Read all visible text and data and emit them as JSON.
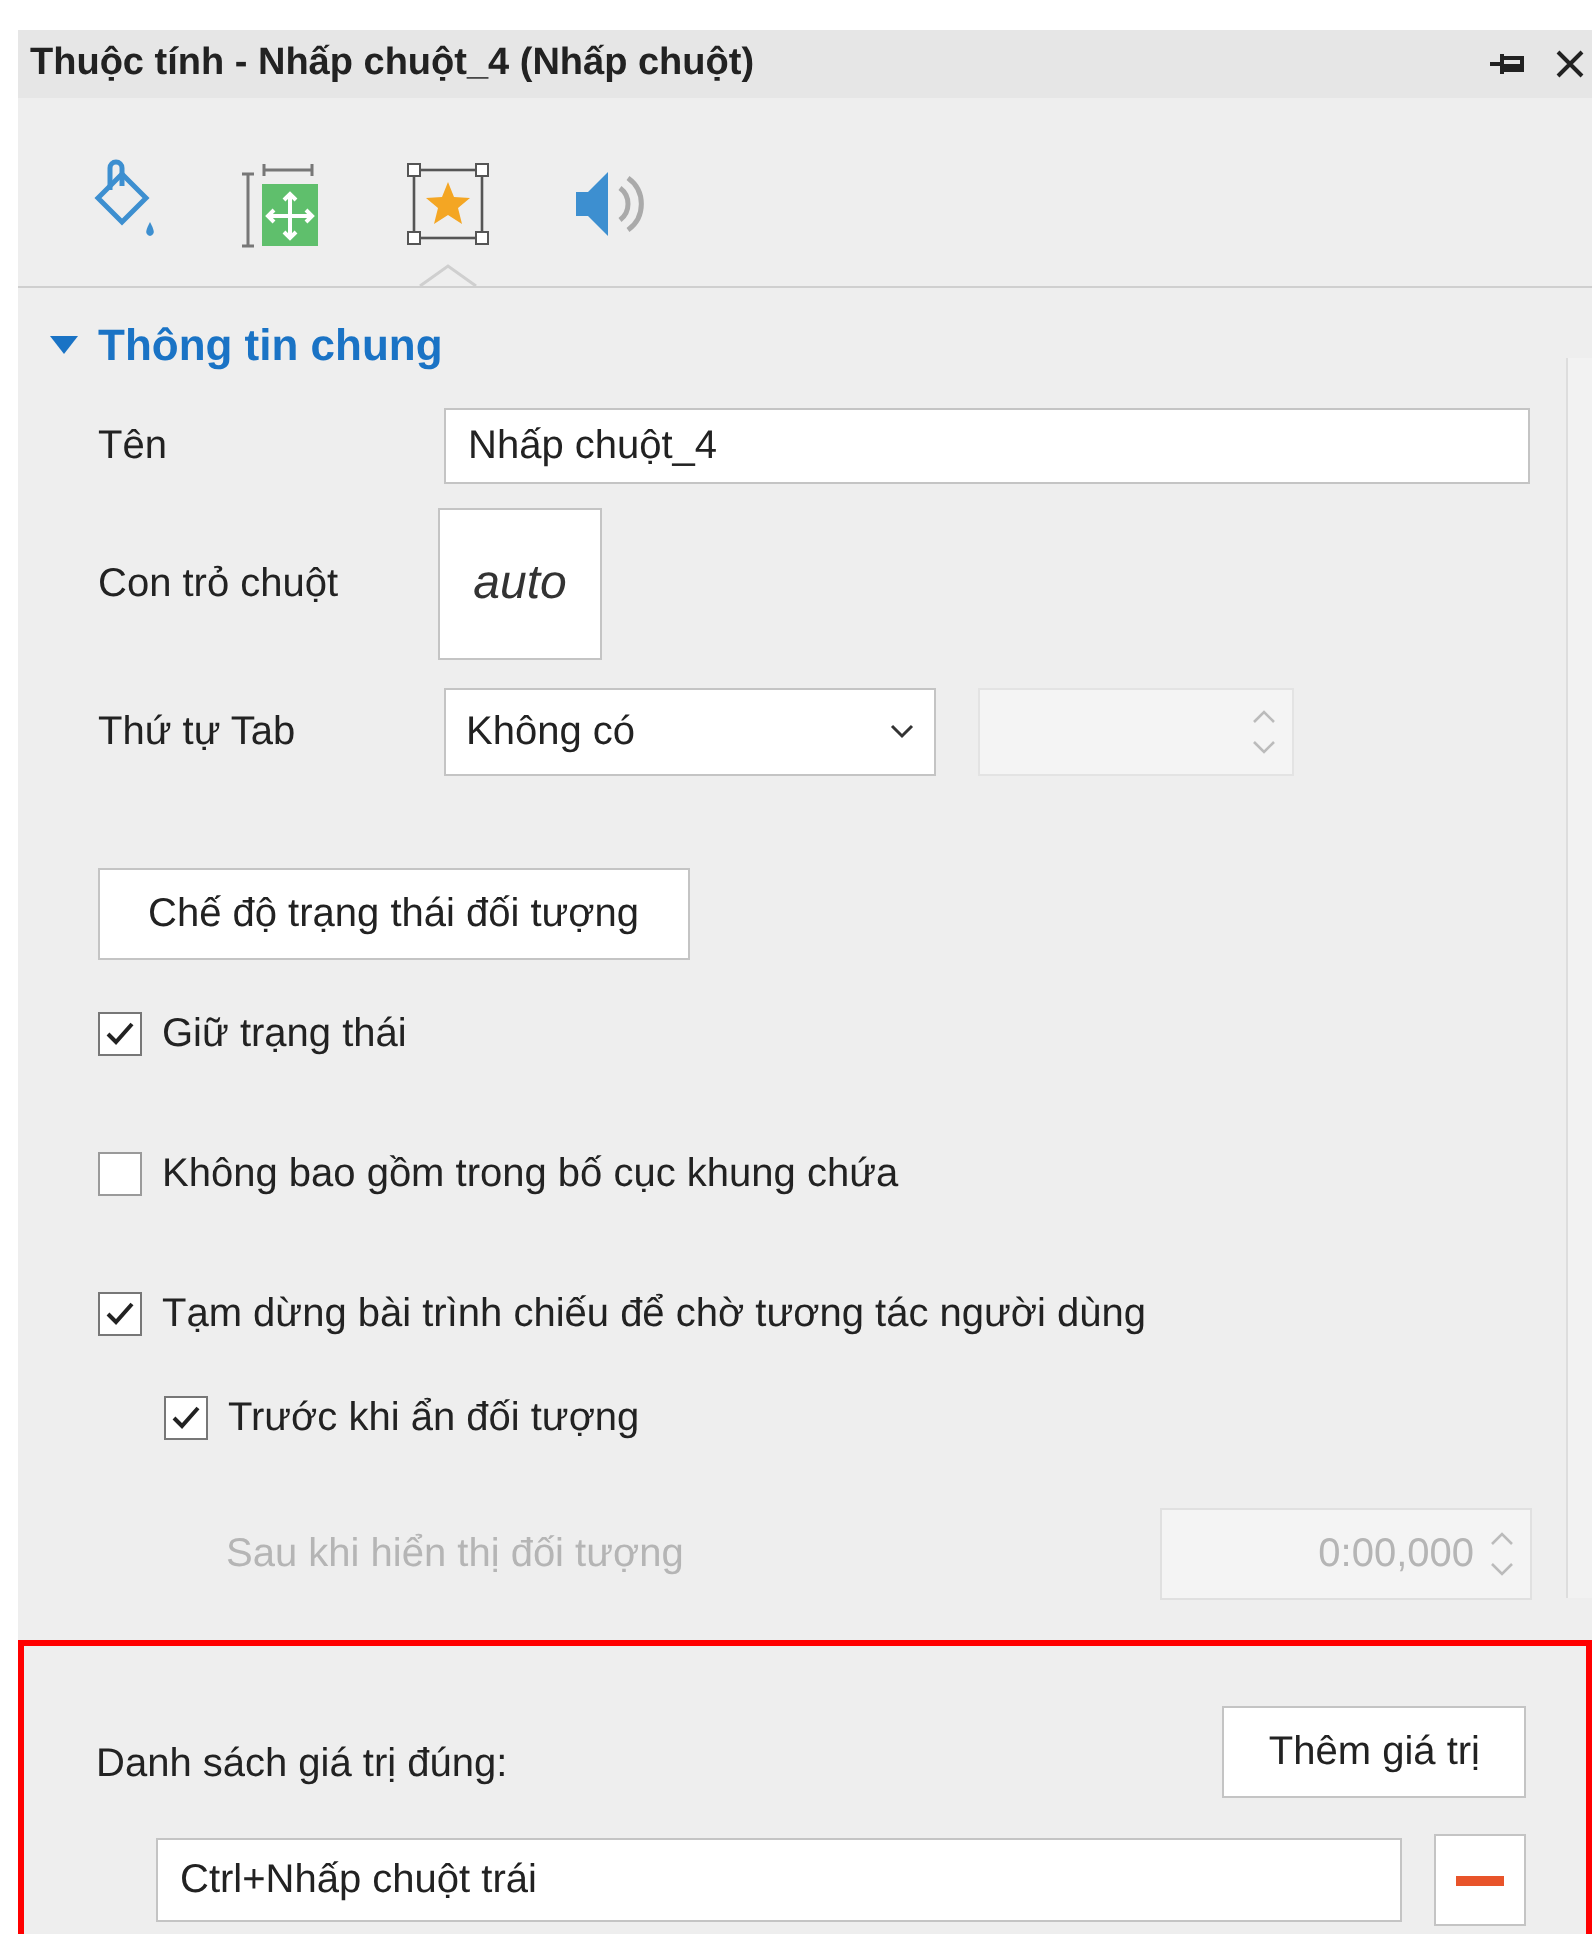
{
  "window": {
    "title": "Thuộc tính - Nhấp chuột_4 (Nhấp chuột)"
  },
  "tabs": [
    {
      "selected": false
    },
    {
      "selected": false
    },
    {
      "selected": true
    },
    {
      "selected": false
    }
  ],
  "section": {
    "title": "Thông tin chung",
    "expanded": true
  },
  "name_field": {
    "label": "Tên",
    "value": "Nhấp chuột_4"
  },
  "cursor": {
    "label": "Con trỏ chuột",
    "value": "auto"
  },
  "tab_order": {
    "label": "Thứ tự Tab",
    "value": "Không có",
    "spinner_disabled": true
  },
  "state_button": "Chế độ trạng thái đối tượng",
  "checkboxes": [
    {
      "label": "Giữ trạng thái",
      "checked": true
    },
    {
      "label": "Không bao gồm trong bố cục khung chứa",
      "checked": false
    },
    {
      "label": "Tạm dừng bài trình chiếu để chờ tương tác người dùng",
      "checked": true,
      "children": [
        {
          "label": "Trước khi ẩn đối tượng",
          "checked": true
        }
      ]
    }
  ],
  "delay": {
    "label": "Sau khi hiển thị đối tượng",
    "value": "0:00,000",
    "disabled": true
  },
  "correct_values": {
    "label": "Danh sách giá trị đúng:",
    "add_button": "Thêm giá trị",
    "items": [
      {
        "value": "Ctrl+Nhấp chuột trái"
      }
    ]
  }
}
